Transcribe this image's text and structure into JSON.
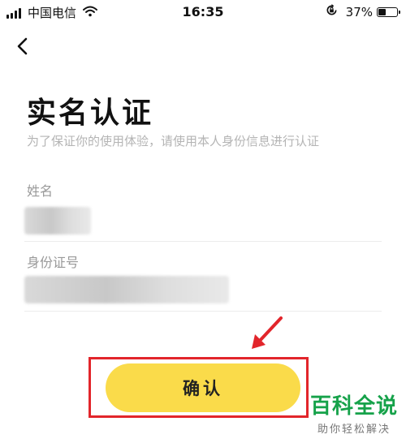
{
  "status_bar": {
    "carrier": "中国电信",
    "time": "16:35",
    "battery_percent": "37%",
    "battery_level": 0.37,
    "icons": [
      "signal-icon",
      "wifi-icon",
      "orientation-lock-icon",
      "battery-icon"
    ]
  },
  "nav": {
    "back_icon": "chevron-left-icon"
  },
  "header": {
    "title": "实名认证",
    "subtitle": "为了保证你的使用体验，请使用本人身份信息进行认证"
  },
  "form": {
    "name_label": "姓名",
    "id_label": "身份证号"
  },
  "actions": {
    "confirm_label": "确认"
  },
  "annotation": {
    "highlight_color": "#e2252b",
    "arrow_color": "#e2252b"
  },
  "watermark": {
    "title": "百科全说",
    "subtitle": "助你轻松解决"
  },
  "colors": {
    "accent_button": "#fadb4a",
    "watermark_green": "#16a24a"
  }
}
